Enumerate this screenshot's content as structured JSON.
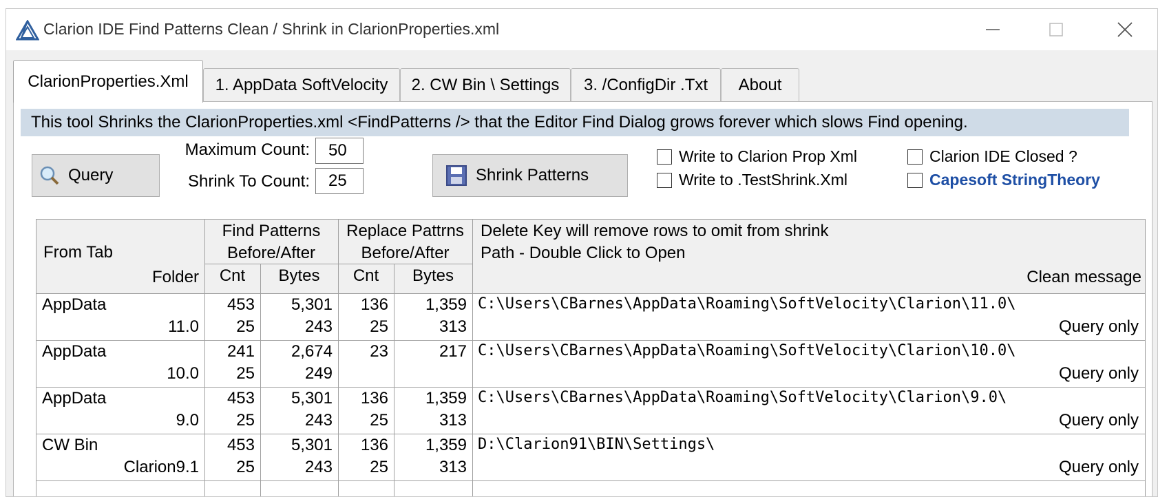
{
  "window": {
    "title": "Clarion IDE Find Patterns Clean / Shrink in ClarionProperties.xml"
  },
  "tabs": [
    {
      "label": "ClarionProperties.Xml",
      "active": true
    },
    {
      "label": "1. AppData SoftVelocity",
      "active": false
    },
    {
      "label": "2. CW Bin \\ Settings",
      "active": false
    },
    {
      "label": "3. /ConfigDir .Txt",
      "active": false
    },
    {
      "label": "About",
      "active": false
    }
  ],
  "banner": "This tool Shrinks the ClarionProperties.xml <FindPatterns /> that the Editor Find Dialog grows forever which slows Find opening.",
  "controls": {
    "query_label": "Query",
    "max_count_label": "Maximum Count:",
    "max_count_value": "50",
    "shrink_to_label": "Shrink To Count:",
    "shrink_to_value": "25",
    "shrink_label": "Shrink Patterns",
    "checks": {
      "write_prop": "Write to Clarion Prop Xml",
      "write_test": "Write to .TestShrink.Xml",
      "ide_closed": "Clarion IDE Closed ?",
      "capesoft": "Capesoft StringTheory"
    }
  },
  "table": {
    "headers": {
      "from_tab": "From Tab",
      "folder": "Folder",
      "find_patterns_1": "Find Patterns",
      "find_patterns_2": "Before/After",
      "replace_1": "Replace Pattrns",
      "replace_2": "Before/After",
      "cnt": "Cnt",
      "bytes": "Bytes",
      "path_1": "Delete Key will remove rows to omit from shrink",
      "path_2": "Path  -  Double Click to Open",
      "clean_message": "Clean message"
    },
    "rows": [
      {
        "from": "AppData",
        "folder": "11.0",
        "find_cnt_before": "453",
        "find_cnt_after": "25",
        "find_bytes_before": "5,301",
        "find_bytes_after": "243",
        "rep_cnt_before": "136",
        "rep_cnt_after": "25",
        "rep_bytes_before": "1,359",
        "rep_bytes_after": "313",
        "path": "C:\\Users\\CBarnes\\AppData\\Roaming\\SoftVelocity\\Clarion\\11.0\\",
        "message": "Query only"
      },
      {
        "from": "AppData",
        "folder": "10.0",
        "find_cnt_before": "241",
        "find_cnt_after": "25",
        "find_bytes_before": "2,674",
        "find_bytes_after": "249",
        "rep_cnt_before": "23",
        "rep_cnt_after": "",
        "rep_bytes_before": "217",
        "rep_bytes_after": "",
        "path": "C:\\Users\\CBarnes\\AppData\\Roaming\\SoftVelocity\\Clarion\\10.0\\",
        "message": "Query only"
      },
      {
        "from": "AppData",
        "folder": "9.0",
        "find_cnt_before": "453",
        "find_cnt_after": "25",
        "find_bytes_before": "5,301",
        "find_bytes_after": "243",
        "rep_cnt_before": "136",
        "rep_cnt_after": "25",
        "rep_bytes_before": "1,359",
        "rep_bytes_after": "313",
        "path": "C:\\Users\\CBarnes\\AppData\\Roaming\\SoftVelocity\\Clarion\\9.0\\",
        "message": "Query only"
      },
      {
        "from": "CW Bin",
        "folder": "Clarion9.1",
        "find_cnt_before": "453",
        "find_cnt_after": "25",
        "find_bytes_before": "5,301",
        "find_bytes_after": "243",
        "rep_cnt_before": "136",
        "rep_cnt_after": "25",
        "rep_bytes_before": "1,359",
        "rep_bytes_after": "313",
        "path": "D:\\Clarion91\\BIN\\Settings\\",
        "message": "Query only"
      }
    ]
  },
  "colors": {
    "banner_bg": "#cfdbe7",
    "link": "#1e4fa5"
  }
}
